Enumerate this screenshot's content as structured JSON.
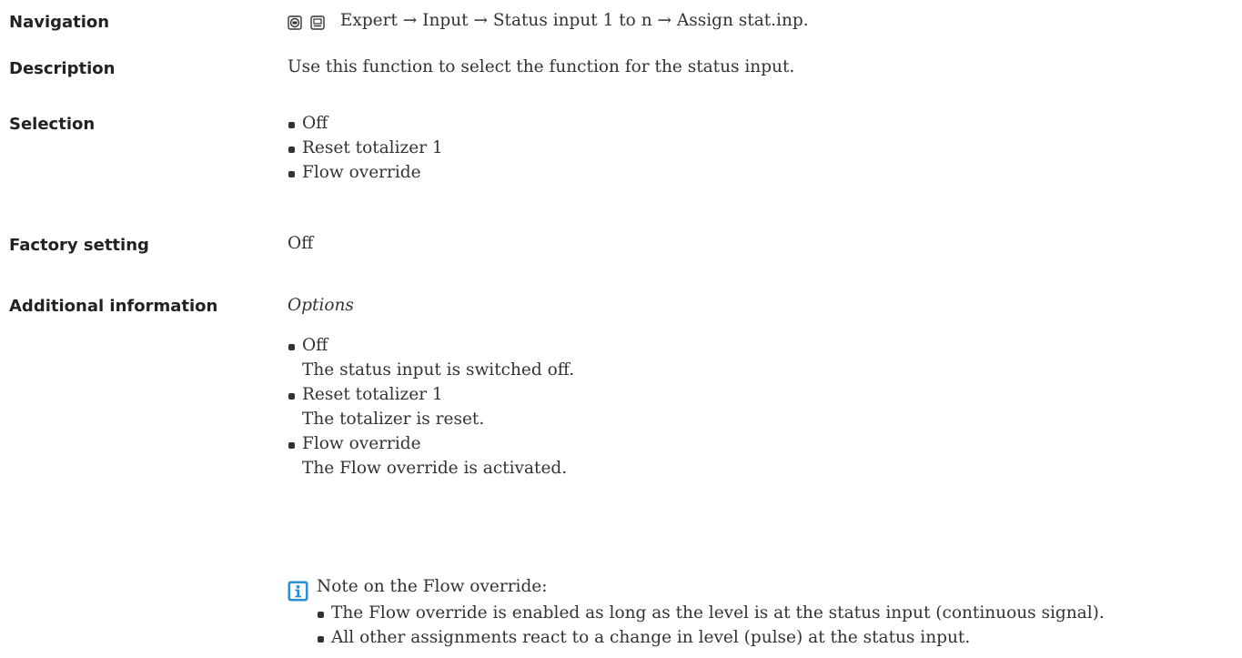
{
  "navigation": {
    "label": "Navigation",
    "path": "Expert → Input → Status input 1 to n → Assign stat.inp."
  },
  "description": {
    "label": "Description",
    "text": "Use this function to select the function for the status input."
  },
  "selection": {
    "label": "Selection",
    "items": [
      "Off",
      "Reset totalizer 1",
      "Flow override"
    ]
  },
  "factory_setting": {
    "label": "Factory setting",
    "value": "Off"
  },
  "additional_information": {
    "label": "Additional information",
    "heading": "Options",
    "options": [
      {
        "name": "Off",
        "desc": "The status input is switched off."
      },
      {
        "name": "Reset totalizer 1",
        "desc": "The totalizer is reset."
      },
      {
        "name": "Flow override",
        "desc": "The Flow override is activated."
      }
    ],
    "note_icon": "info-icon",
    "note_title": "Note on the Flow override:",
    "note_items": [
      "The Flow override is enabled as long as the level is at the status input (continuous signal).",
      "All other assignments react to a change in level (pulse) at the status input."
    ]
  },
  "colors": {
    "info_icon": "#2b8fd6",
    "text": "#333333"
  }
}
